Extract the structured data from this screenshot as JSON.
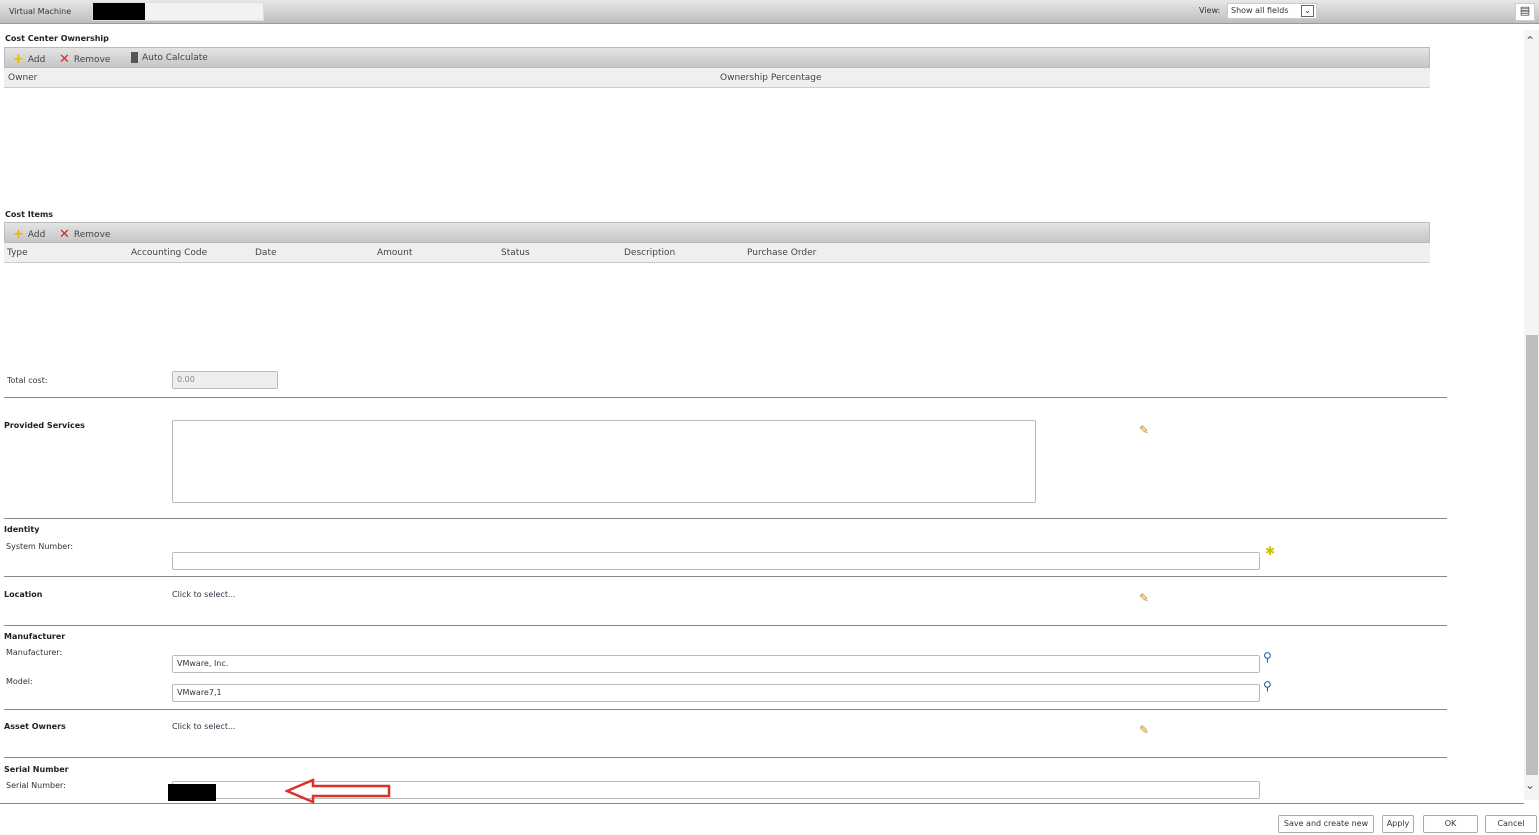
{
  "window": {
    "title": "Virtual Machine",
    "view_label": "View:",
    "view_value": "Show all fields"
  },
  "cost_center": {
    "title": "Cost Center Ownership",
    "add": "Add",
    "remove": "Remove",
    "auto": "Auto Calculate",
    "columns": [
      "Owner",
      "Ownership Percentage"
    ]
  },
  "cost_items": {
    "title": "Cost Items",
    "add": "Add",
    "remove": "Remove",
    "columns": [
      "Type",
      "Accounting Code",
      "Date",
      "Amount",
      "Status",
      "Description",
      "Purchase Order"
    ]
  },
  "total_cost": {
    "label": "Total cost:",
    "value": "0.00"
  },
  "provided_services": {
    "title": "Provided Services"
  },
  "identity": {
    "title": "Identity",
    "system_number_label": "System Number:",
    "system_number": ""
  },
  "location": {
    "title": "Location",
    "link": "Click to select..."
  },
  "manufacturer": {
    "title": "Manufacturer",
    "manufacturer_label": "Manufacturer:",
    "manufacturer_value": "VMware, Inc.",
    "model_label": "Model:",
    "model_value": "VMware7,1"
  },
  "asset_owners": {
    "title": "Asset Owners",
    "link": "Click to select..."
  },
  "serial": {
    "title": "Serial Number",
    "label": "Serial Number:"
  },
  "buttons": {
    "save_new": "Save and create new",
    "apply": "Apply",
    "ok": "OK",
    "cancel": "Cancel"
  },
  "colors": {
    "arrow": "#d9312b",
    "link": "#334455"
  }
}
